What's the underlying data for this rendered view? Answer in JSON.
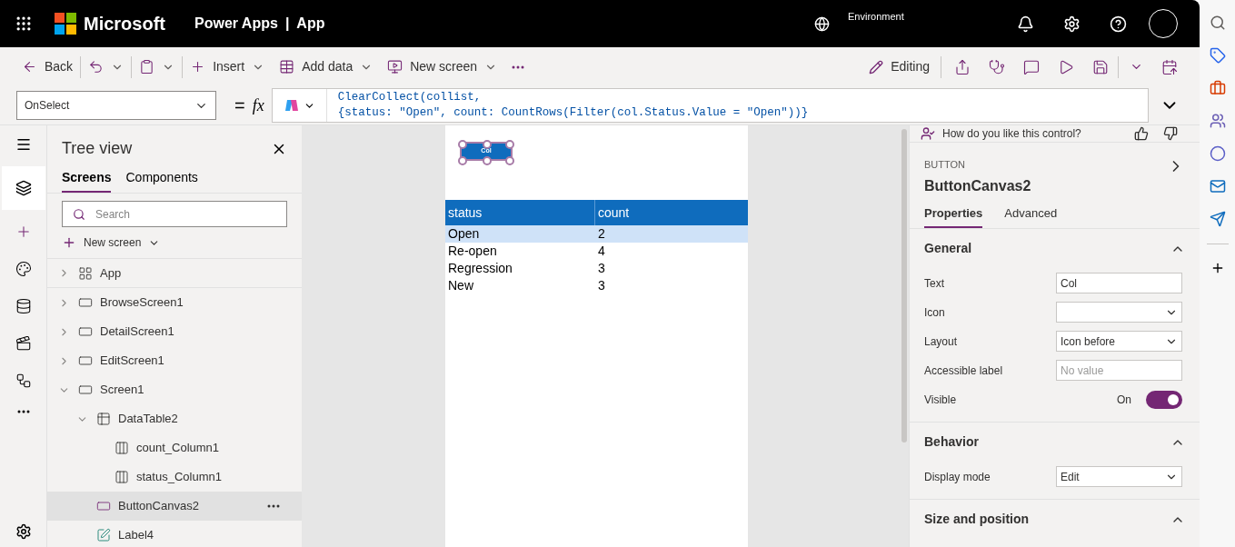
{
  "header": {
    "brand": "Microsoft",
    "product": "Power Apps",
    "separator": "|",
    "app": "App",
    "environment_label": "Environment"
  },
  "toolbar": {
    "left": [
      {
        "kind": "back",
        "label": "Back"
      },
      {
        "kind": "undo"
      },
      {
        "kind": "paste"
      },
      {
        "kind": "insert",
        "label": "Insert"
      },
      {
        "kind": "data",
        "label": "Add data"
      },
      {
        "kind": "screen",
        "label": "New screen"
      },
      {
        "kind": "more"
      }
    ],
    "editing": "Editing"
  },
  "formula": {
    "property": "OnSelect",
    "equals": "=",
    "fx": "fx",
    "lines": [
      "ClearCollect(collist,",
      "{status: \"Open\", count: CountRows(Filter(col.Status.Value = \"Open\"))}"
    ]
  },
  "tree": {
    "title": "Tree view",
    "tabs": [
      {
        "label": "Screens",
        "selected": true
      },
      {
        "label": "Components",
        "selected": false
      }
    ],
    "search_placeholder": "Search",
    "new_screen": "New screen",
    "items": [
      {
        "kind": "app",
        "label": "App",
        "expanded": false,
        "selected": false
      },
      {
        "kind": "screen",
        "label": "BrowseScreen1",
        "expanded": false,
        "selected": false
      },
      {
        "kind": "screen",
        "label": "DetailScreen1",
        "expanded": false,
        "selected": false
      },
      {
        "kind": "screen",
        "label": "EditScreen1",
        "expanded": false,
        "selected": false
      },
      {
        "kind": "screen",
        "label": "Screen1",
        "expanded": true,
        "selected": false,
        "children": [
          {
            "kind": "table",
            "label": "DataTable2",
            "expanded": true,
            "selected": false,
            "children": [
              {
                "kind": "column",
                "label": "count_Column1",
                "selected": false
              },
              {
                "kind": "column",
                "label": "status_Column1",
                "selected": false
              }
            ]
          },
          {
            "kind": "button",
            "label": "ButtonCanvas2",
            "selected": true
          },
          {
            "kind": "label",
            "label": "Label4",
            "selected": false
          }
        ]
      }
    ]
  },
  "canvas": {
    "button_text": "Col",
    "columns": [
      "status",
      "count"
    ],
    "rows": [
      {
        "cells": [
          "Open",
          "2"
        ],
        "selected": true
      },
      {
        "cells": [
          "Re-open",
          "4"
        ],
        "selected": false
      },
      {
        "cells": [
          "Regression",
          "3"
        ],
        "selected": false
      },
      {
        "cells": [
          "New",
          "3"
        ],
        "selected": false
      }
    ]
  },
  "properties": {
    "feedback": "How do you like this control?",
    "type": "BUTTON",
    "name": "ButtonCanvas2",
    "tabs": [
      {
        "label": "Properties",
        "selected": true
      },
      {
        "label": "Advanced",
        "selected": false
      }
    ],
    "sections": [
      {
        "title": "General",
        "expanded": true,
        "fields": [
          {
            "kind": "text",
            "label": "Text",
            "value": "Col"
          },
          {
            "kind": "select",
            "label": "Icon"
          },
          {
            "kind": "select",
            "label": "Layout",
            "value": "Icon before"
          },
          {
            "kind": "text",
            "label": "Accessible label",
            "placeholder": "No value"
          },
          {
            "kind": "toggle",
            "label": "Visible",
            "value": "On",
            "on": true
          }
        ]
      },
      {
        "title": "Behavior",
        "expanded": true,
        "fields": [
          {
            "kind": "select",
            "label": "Display mode",
            "value": "Edit"
          }
        ]
      },
      {
        "title": "Size and position",
        "expanded": true
      }
    ]
  }
}
